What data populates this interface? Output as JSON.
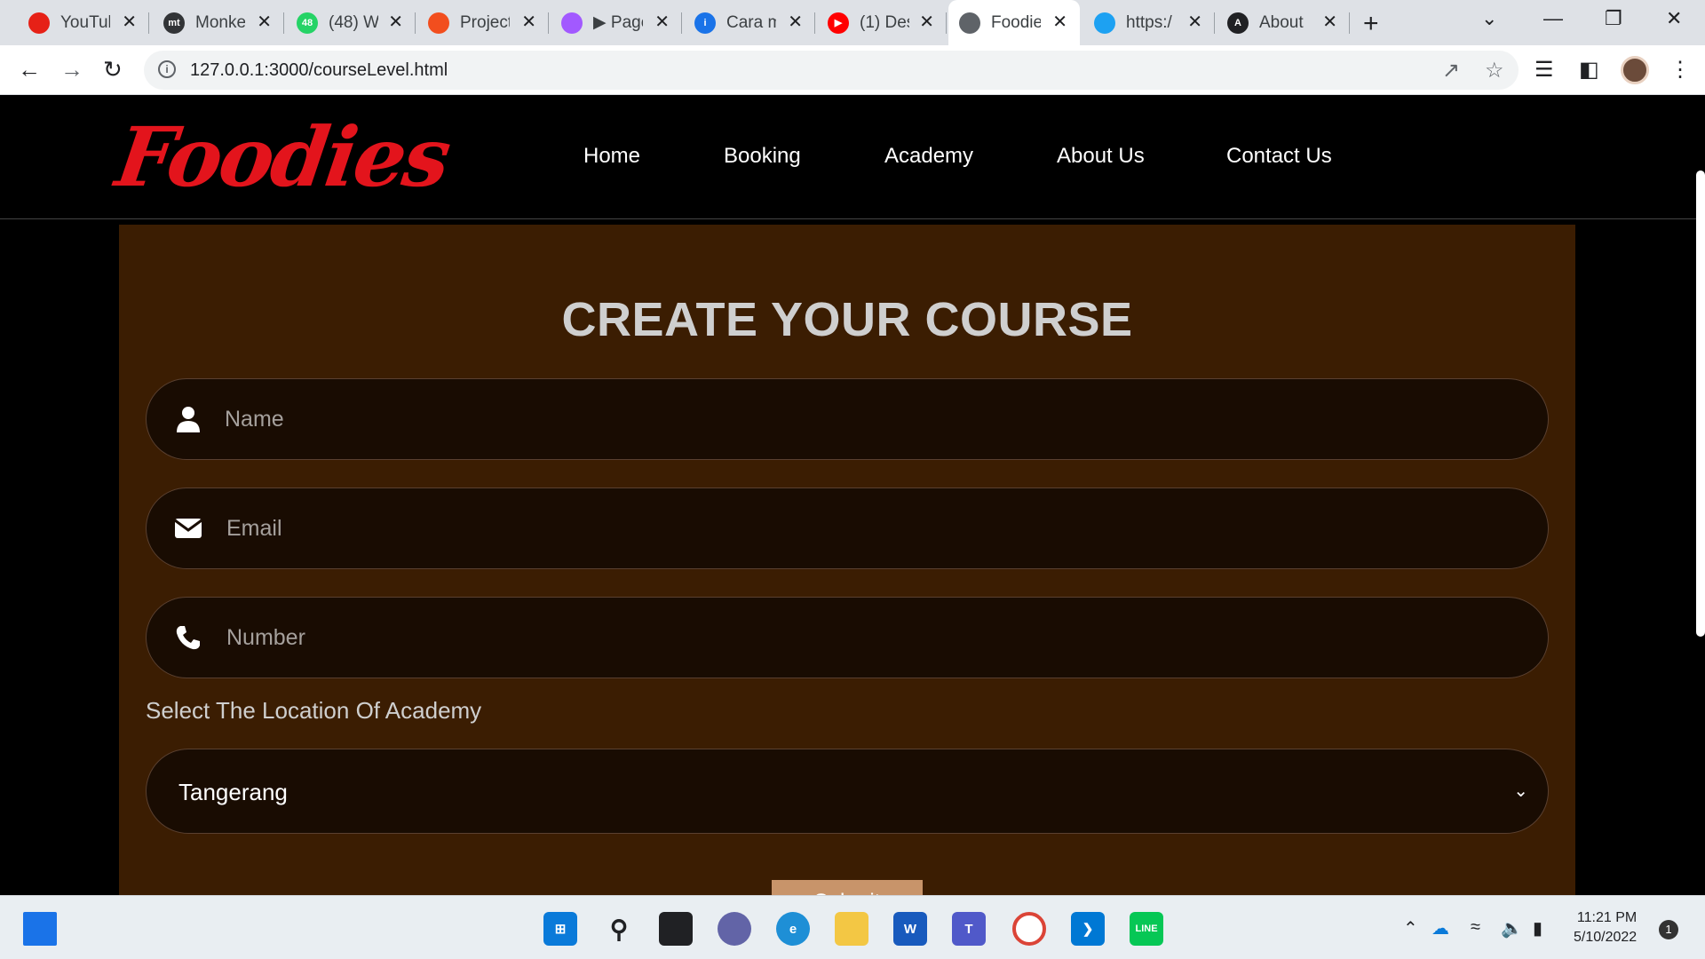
{
  "browser": {
    "tabs": [
      {
        "title": "YouTube",
        "icon": "youtube-icon",
        "color": "#e62117",
        "glyph": ""
      },
      {
        "title": "Monke",
        "icon": "monkeytype-icon",
        "color": "#323437",
        "glyph": "mt"
      },
      {
        "title": "(48) W",
        "icon": "whatsapp-icon",
        "color": "#25d366",
        "glyph": "48"
      },
      {
        "title": "Project",
        "icon": "figma-icon",
        "color": "#f24e1e",
        "glyph": ""
      },
      {
        "title": "▶ Page",
        "icon": "figma-icon",
        "color": "#a259ff",
        "glyph": ""
      },
      {
        "title": "Cara m",
        "icon": "info-icon",
        "color": "#1a73e8",
        "glyph": "i"
      },
      {
        "title": "(1) Des",
        "icon": "youtube-icon",
        "color": "#ff0000",
        "glyph": "▶"
      },
      {
        "title": "Foodie",
        "icon": "globe-icon",
        "color": "#5f6368",
        "glyph": ""
      },
      {
        "title": "https:/",
        "icon": "twitter-icon",
        "color": "#1da1f2",
        "glyph": ""
      },
      {
        "title": "About",
        "icon": "angular-icon",
        "color": "#202124",
        "glyph": "A"
      }
    ],
    "active_tab_index": 7,
    "url": "127.0.0.1:3000/courseLevel.html"
  },
  "site": {
    "logo": "Foodies",
    "logo_color": "#e3141c",
    "nav": [
      "Home",
      "Booking",
      "Academy",
      "About Us",
      "Contact Us"
    ]
  },
  "form": {
    "title": "CREATE YOUR COURSE",
    "name_placeholder": "Name",
    "email_placeholder": "Email",
    "number_placeholder": "Number",
    "location_label": "Select The Location Of Academy",
    "location_selected": "Tangerang",
    "submit_label": "Submit",
    "panel_color": "#3b1d02",
    "field_color": "#190c02",
    "submit_color": "#c8946a"
  },
  "taskbar": {
    "time": "11:21 PM",
    "date": "5/10/2022",
    "notifications": "1"
  }
}
